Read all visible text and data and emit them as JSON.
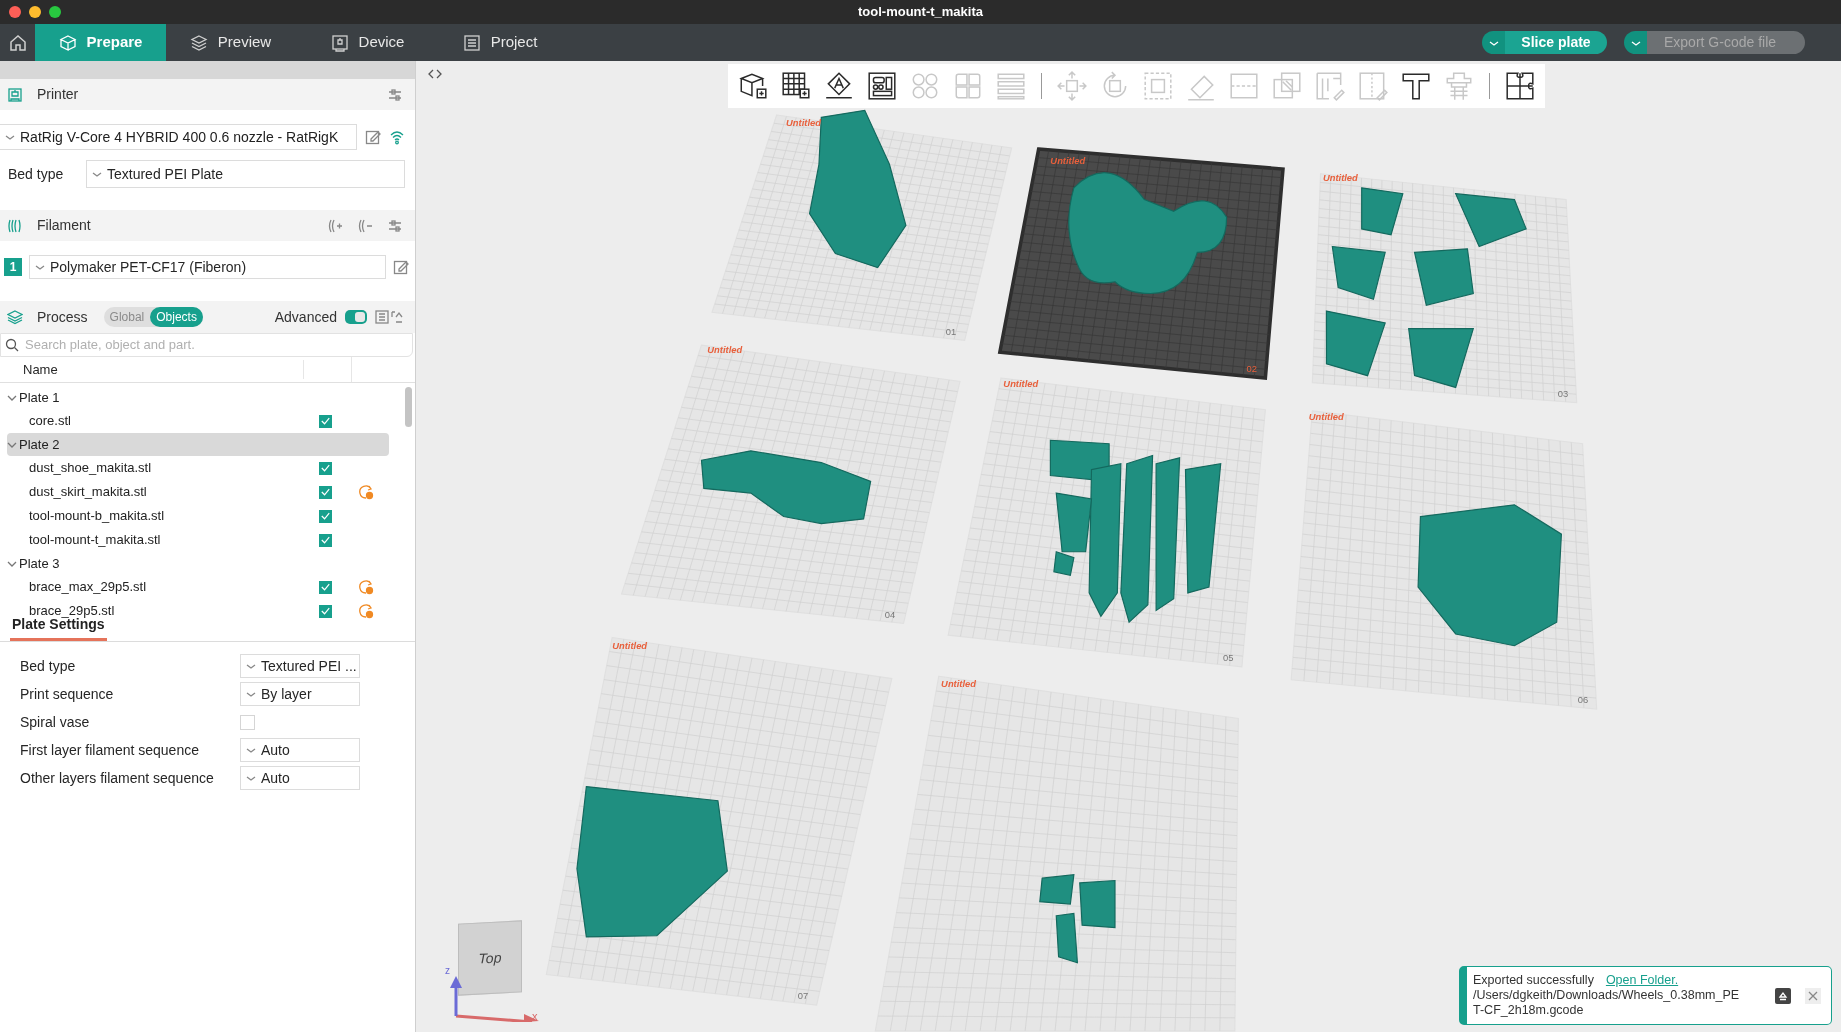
{
  "window": {
    "title": "tool-mount-t_makita"
  },
  "tabs": [
    {
      "label": "Prepare",
      "selected": true
    },
    {
      "label": "Preview",
      "selected": false
    },
    {
      "label": "Device",
      "selected": false
    },
    {
      "label": "Project",
      "selected": false
    }
  ],
  "actions": [
    {
      "label": "Slice plate",
      "disabled": false
    },
    {
      "label": "Export G-code file",
      "disabled": true
    }
  ],
  "printer": {
    "title": "Printer",
    "preset": "RatRig V-Core 4 HYBRID 400 0.6 nozzle - RatRigK",
    "bed_type_label": "Bed type",
    "bed_type": "Textured PEI Plate"
  },
  "filament": {
    "title": "Filament",
    "slots": [
      {
        "number": "1",
        "preset": "Polymaker PET-CF17 (Fiberon)"
      }
    ]
  },
  "process": {
    "title": "Process",
    "modes": [
      {
        "label": "Global",
        "selected": false
      },
      {
        "label": "Objects",
        "selected": true
      }
    ],
    "advanced_label": "Advanced",
    "advanced": true
  },
  "object_list": {
    "search_placeholder": "Search plate, object and part.",
    "columns": [
      "Name"
    ],
    "plates": [
      {
        "name": "Plate 1",
        "expanded": true,
        "selected": false,
        "children": [
          {
            "name": "core.stl",
            "checked": true,
            "modified": false
          }
        ]
      },
      {
        "name": "Plate 2",
        "expanded": true,
        "selected": true,
        "children": [
          {
            "name": "dust_shoe_makita.stl",
            "checked": true,
            "modified": false
          },
          {
            "name": "dust_skirt_makita.stl",
            "checked": true,
            "modified": true
          },
          {
            "name": "tool-mount-b_makita.stl",
            "checked": true,
            "modified": false
          },
          {
            "name": "tool-mount-t_makita.stl",
            "checked": true,
            "modified": false
          }
        ]
      },
      {
        "name": "Plate 3",
        "expanded": true,
        "selected": false,
        "children": [
          {
            "name": "brace_max_29p5.stl",
            "checked": true,
            "modified": true
          },
          {
            "name": "brace_29p5.stl",
            "checked": true,
            "modified": true
          }
        ]
      }
    ]
  },
  "plate_settings": {
    "tab": "Plate Settings",
    "rows": [
      {
        "kind": "select",
        "label": "Bed type",
        "value": "Textured PEI ..."
      },
      {
        "kind": "select",
        "label": "Print sequence",
        "value": "By layer"
      },
      {
        "kind": "checkbox",
        "label": "Spiral vase",
        "checked": false
      },
      {
        "kind": "select",
        "label": "First layer filament sequence",
        "value": "Auto"
      },
      {
        "kind": "select",
        "label": "Other layers filament sequence",
        "value": "Auto"
      }
    ]
  },
  "toolbar": {
    "groups": [
      [
        {
          "disabled": false
        },
        {
          "disabled": false
        },
        {
          "disabled": false
        },
        {
          "disabled": false
        },
        {
          "disabled": true
        },
        {
          "disabled": true
        },
        {
          "disabled": true
        }
      ],
      [
        {
          "disabled": true
        },
        {
          "disabled": true
        },
        {
          "disabled": true
        },
        {
          "disabled": true
        },
        {
          "disabled": true
        },
        {
          "disabled": true
        },
        {
          "disabled": true
        },
        {
          "disabled": true
        },
        {
          "disabled": false
        },
        {
          "disabled": true
        }
      ],
      [
        {
          "disabled": false
        }
      ]
    ]
  },
  "plates": [
    {
      "label": "Untitled",
      "number": "01",
      "selected": false
    },
    {
      "label": "Untitled",
      "number": "02",
      "selected": true
    },
    {
      "label": "Untitled",
      "number": "03",
      "selected": false
    },
    {
      "label": "Untitled",
      "number": "04",
      "selected": false
    },
    {
      "label": "Untitled",
      "number": "05",
      "selected": false
    },
    {
      "label": "Untitled",
      "number": "06",
      "selected": false
    },
    {
      "label": "Untitled",
      "number": "07",
      "selected": false
    },
    {
      "label": "Untitled",
      "selected": false
    }
  ],
  "view_cube": {
    "face": "Top",
    "x_axis": "x",
    "z_axis": "z"
  },
  "notification": {
    "message": "Exported successfully",
    "link": "Open Folder.",
    "path": "/Users/dgkeith/Downloads/Wheels_0.38mm_PET-CF_2h18m.gcode"
  }
}
